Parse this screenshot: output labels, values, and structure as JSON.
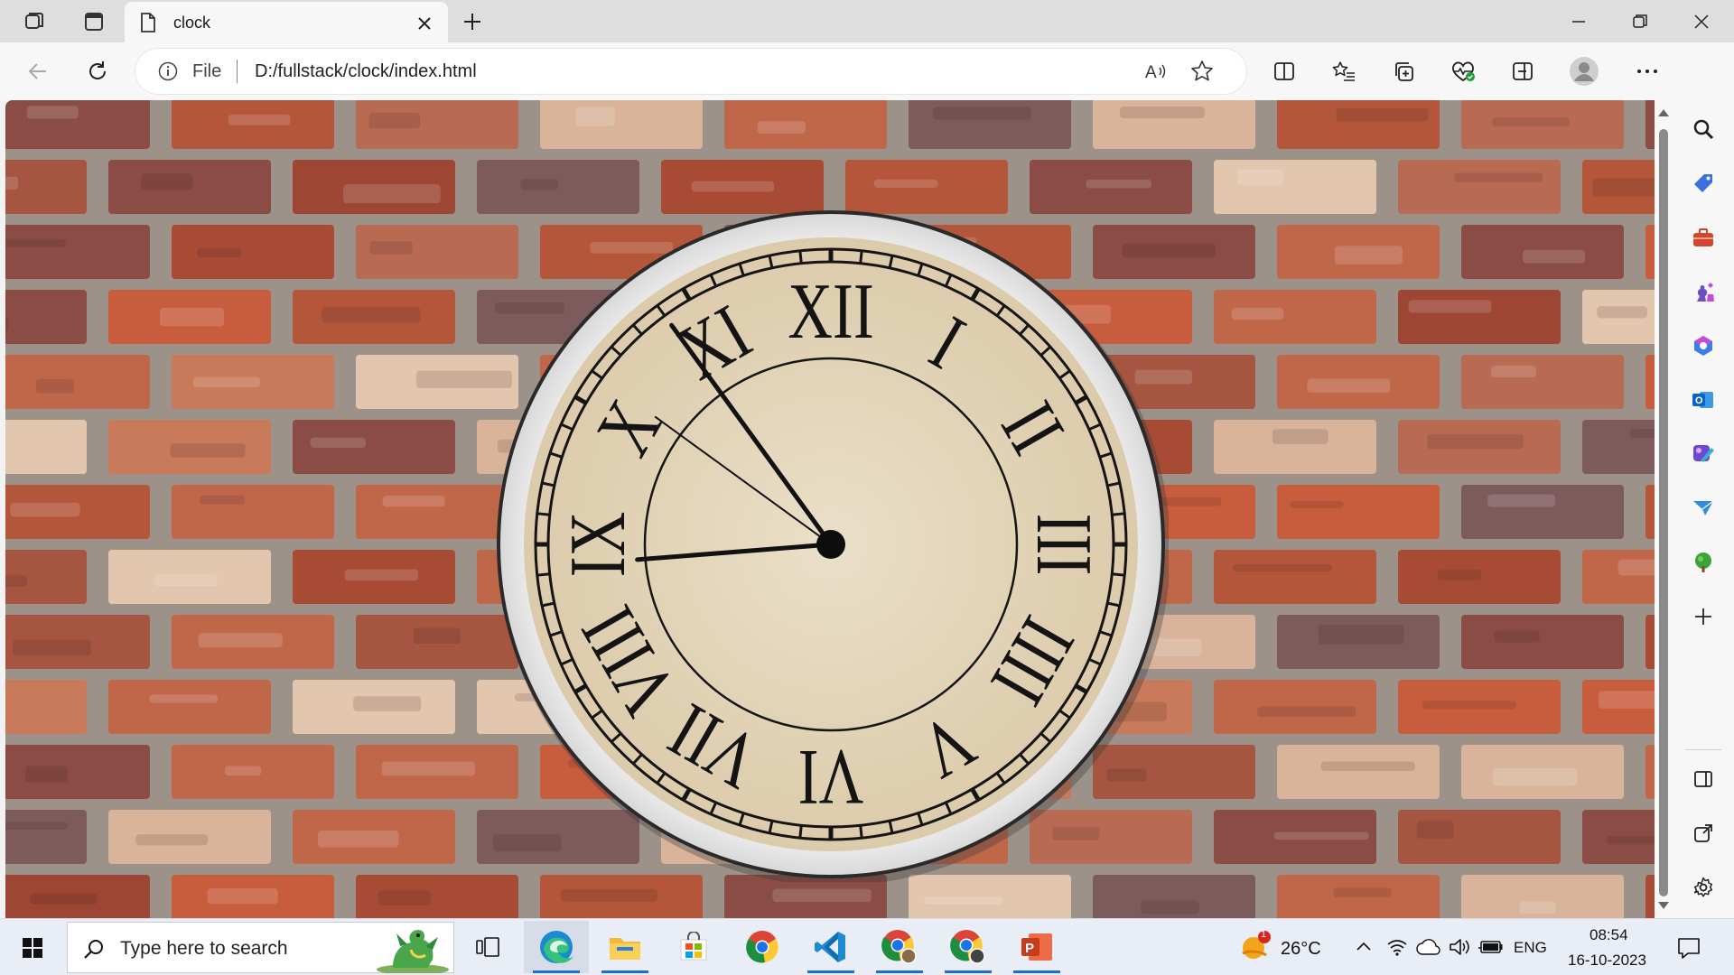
{
  "browser": {
    "tab_title": "clock",
    "address_scheme": "File",
    "address_url": "D:/fullstack/clock/index.html"
  },
  "clock": {
    "numerals": [
      "XII",
      "I",
      "II",
      "III",
      "IIII",
      "V",
      "VI",
      "VII",
      "VIII",
      "IX",
      "X",
      "XI"
    ],
    "hour_hand_to_hour": 8.85,
    "minute_hand_to_minute": 54,
    "second_hand_to_second": 51
  },
  "colors": {
    "brick": "#b25a3e",
    "dial": "#e6d8bd",
    "bezel": "#e9e9e9",
    "accent": "#1c6fd1"
  },
  "taskbar": {
    "search_placeholder": "Type here to search",
    "weather": "26°C",
    "weather_badge": "1",
    "language": "ENG",
    "time": "08:54",
    "date": "16-10-2023",
    "apps": [
      "task-view",
      "edge",
      "file-explorer",
      "microsoft-store",
      "chrome",
      "vscode",
      "chrome-profile-1",
      "chrome-profile-2",
      "powerpoint"
    ]
  },
  "sidebar": {
    "items": [
      "search",
      "shopping",
      "tools",
      "games",
      "microsoft-365",
      "outlook",
      "designer",
      "drop",
      "tree",
      "add"
    ]
  }
}
